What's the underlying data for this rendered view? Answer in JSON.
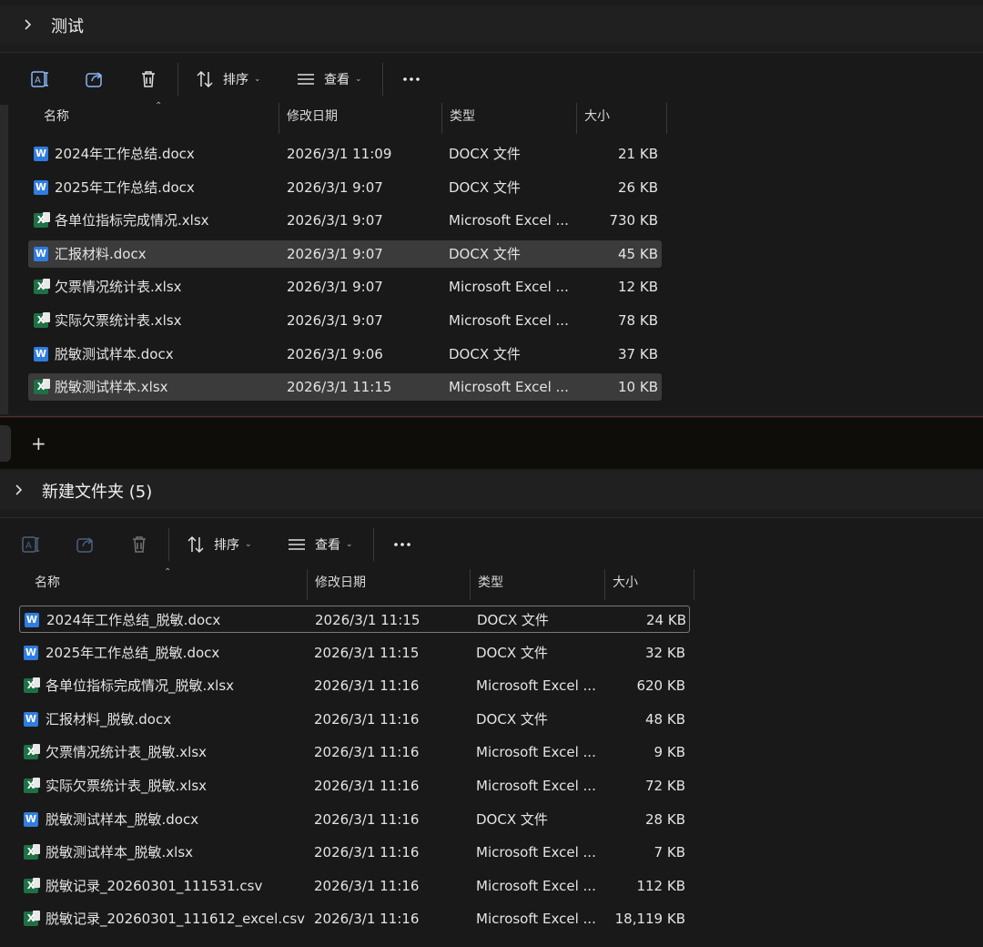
{
  "panes": [
    {
      "folder": "测试",
      "toolbar": {
        "sort_label": "排序",
        "view_label": "查看"
      },
      "columns": {
        "name": "名称",
        "date": "修改日期",
        "type": "类型",
        "size": "大小"
      },
      "files": [
        {
          "name": "2024年工作总结.docx",
          "date": "2026/3/1 11:09",
          "type": "DOCX 文件",
          "size": "21 KB",
          "kind": "word"
        },
        {
          "name": "2025年工作总结.docx",
          "date": "2026/3/1 9:07",
          "type": "DOCX 文件",
          "size": "26 KB",
          "kind": "word"
        },
        {
          "name": "各单位指标完成情况.xlsx",
          "date": "2026/3/1 9:07",
          "type": "Microsoft Excel ...",
          "size": "730 KB",
          "kind": "excel"
        },
        {
          "name": "汇报材料.docx",
          "date": "2026/3/1 9:07",
          "type": "DOCX 文件",
          "size": "45 KB",
          "kind": "word",
          "selected": true
        },
        {
          "name": "欠票情况统计表.xlsx",
          "date": "2026/3/1 9:07",
          "type": "Microsoft Excel ...",
          "size": "12 KB",
          "kind": "excel"
        },
        {
          "name": "实际欠票统计表.xlsx",
          "date": "2026/3/1 9:07",
          "type": "Microsoft Excel ...",
          "size": "78 KB",
          "kind": "excel"
        },
        {
          "name": "脱敏测试样本.docx",
          "date": "2026/3/1 9:06",
          "type": "DOCX 文件",
          "size": "37 KB",
          "kind": "word"
        },
        {
          "name": "脱敏测试样本.xlsx",
          "date": "2026/3/1 11:15",
          "type": "Microsoft Excel ...",
          "size": "10 KB",
          "kind": "excel",
          "selected": true
        }
      ]
    },
    {
      "folder": "新建文件夹 (5)",
      "toolbar": {
        "sort_label": "排序",
        "view_label": "查看"
      },
      "columns": {
        "name": "名称",
        "date": "修改日期",
        "type": "类型",
        "size": "大小"
      },
      "files": [
        {
          "name": "2024年工作总结_脱敏.docx",
          "date": "2026/3/1 11:15",
          "type": "DOCX 文件",
          "size": "24 KB",
          "kind": "word",
          "focused": true
        },
        {
          "name": "2025年工作总结_脱敏.docx",
          "date": "2026/3/1 11:15",
          "type": "DOCX 文件",
          "size": "32 KB",
          "kind": "word"
        },
        {
          "name": "各单位指标完成情况_脱敏.xlsx",
          "date": "2026/3/1 11:16",
          "type": "Microsoft Excel ...",
          "size": "620 KB",
          "kind": "excel"
        },
        {
          "name": "汇报材料_脱敏.docx",
          "date": "2026/3/1 11:16",
          "type": "DOCX 文件",
          "size": "48 KB",
          "kind": "word"
        },
        {
          "name": "欠票情况统计表_脱敏.xlsx",
          "date": "2026/3/1 11:16",
          "type": "Microsoft Excel ...",
          "size": "9 KB",
          "kind": "excel"
        },
        {
          "name": "实际欠票统计表_脱敏.xlsx",
          "date": "2026/3/1 11:16",
          "type": "Microsoft Excel ...",
          "size": "72 KB",
          "kind": "excel"
        },
        {
          "name": "脱敏测试样本_脱敏.docx",
          "date": "2026/3/1 11:16",
          "type": "DOCX 文件",
          "size": "28 KB",
          "kind": "word"
        },
        {
          "name": "脱敏测试样本_脱敏.xlsx",
          "date": "2026/3/1 11:16",
          "type": "Microsoft Excel ...",
          "size": "7 KB",
          "kind": "excel"
        },
        {
          "name": "脱敏记录_20260301_111531.csv",
          "date": "2026/3/1 11:16",
          "type": "Microsoft Excel ...",
          "size": "112 KB",
          "kind": "excel"
        },
        {
          "name": "脱敏记录_20260301_111612_excel.csv",
          "date": "2026/3/1 11:16",
          "type": "Microsoft Excel ...",
          "size": "18,119 KB",
          "kind": "excel"
        }
      ]
    }
  ],
  "tabstrip": {
    "new_tab_label": "+"
  },
  "icons": {
    "word": "W",
    "excel": "X"
  }
}
